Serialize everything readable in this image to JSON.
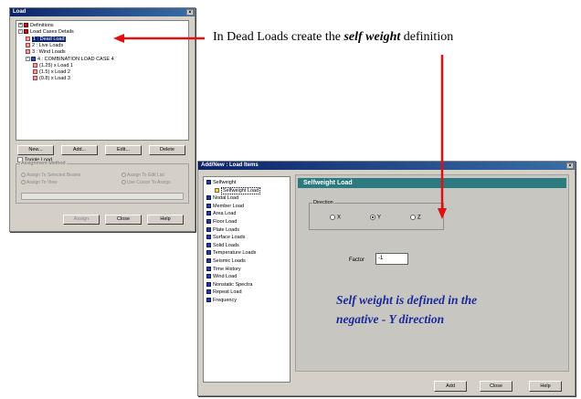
{
  "load_dialog": {
    "title": "Load",
    "close_glyph": "×",
    "tree": [
      {
        "level": 0,
        "expander": "+",
        "icon": "red",
        "label": "Definitions"
      },
      {
        "level": 0,
        "expander": "-",
        "icon": "red",
        "label": "Load Cases Details"
      },
      {
        "level": 1,
        "expander": "",
        "icon": "pink",
        "label": "1 : Dead Load",
        "selected": true
      },
      {
        "level": 1,
        "expander": "",
        "icon": "pink",
        "label": "2 : Live Loads"
      },
      {
        "level": 1,
        "expander": "",
        "icon": "pink",
        "label": "3 : Wind Loads"
      },
      {
        "level": 1,
        "expander": "-",
        "icon": "blue",
        "label": "4 : COMBINATION LOAD CASE 4"
      },
      {
        "level": 2,
        "expander": "",
        "icon": "pink",
        "label": "(1.25) x Load 1"
      },
      {
        "level": 2,
        "expander": "",
        "icon": "pink",
        "label": "(1.5) x Load 2"
      },
      {
        "level": 2,
        "expander": "",
        "icon": "pink",
        "label": "(0.8) x Load 3"
      }
    ],
    "buttons": {
      "new": "New...",
      "add": "Add...",
      "edit": "Edit...",
      "delete": "Delete"
    },
    "toggle_load": "Toggle Load",
    "assignment_method": {
      "caption": "Assignment Method",
      "options": [
        "Assign To Selected Beams",
        "Assign To View",
        "Assign To Edit List",
        "Use Cursor To Assign"
      ]
    },
    "bottom_buttons": {
      "assign": "Assign",
      "close": "Close",
      "help": "Help"
    }
  },
  "annotation": {
    "prefix": "In Dead Loads create the ",
    "emphasis": "self weight",
    "suffix": " definition",
    "arrow_color": "#e01010"
  },
  "add_dialog": {
    "title": "Add/New : Load Items",
    "close_glyph": "×",
    "types": [
      {
        "label": "Selfweight",
        "child": false
      },
      {
        "label": "Selfweight Load",
        "child": true,
        "selected": true
      },
      {
        "label": "Nodal Load",
        "child": false
      },
      {
        "label": "Member Load",
        "child": false
      },
      {
        "label": "Area Load",
        "child": false
      },
      {
        "label": "Floor Load",
        "child": false
      },
      {
        "label": "Plate Loads",
        "child": false
      },
      {
        "label": "Surface Loads",
        "child": false
      },
      {
        "label": "Solid Loads",
        "child": false
      },
      {
        "label": "Temperature Loads",
        "child": false
      },
      {
        "label": "Seismic Loads",
        "child": false
      },
      {
        "label": "Time History",
        "child": false
      },
      {
        "label": "Wind Load",
        "child": false
      },
      {
        "label": "Nonstatic Spectra",
        "child": false
      },
      {
        "label": "Repeat Load",
        "child": false
      },
      {
        "label": "Frequency",
        "child": false
      }
    ],
    "panel_title": "Selfweight Load",
    "direction": {
      "caption": "Direction",
      "options": [
        "X",
        "Y",
        "Z"
      ],
      "selected": "Y"
    },
    "factor": {
      "label": "Factor",
      "value": "-1"
    },
    "note_line1": "Self weight is defined in the",
    "note_line2": "negative  - Y direction",
    "buttons": {
      "add": "Add",
      "close": "Close",
      "help": "Help"
    }
  }
}
